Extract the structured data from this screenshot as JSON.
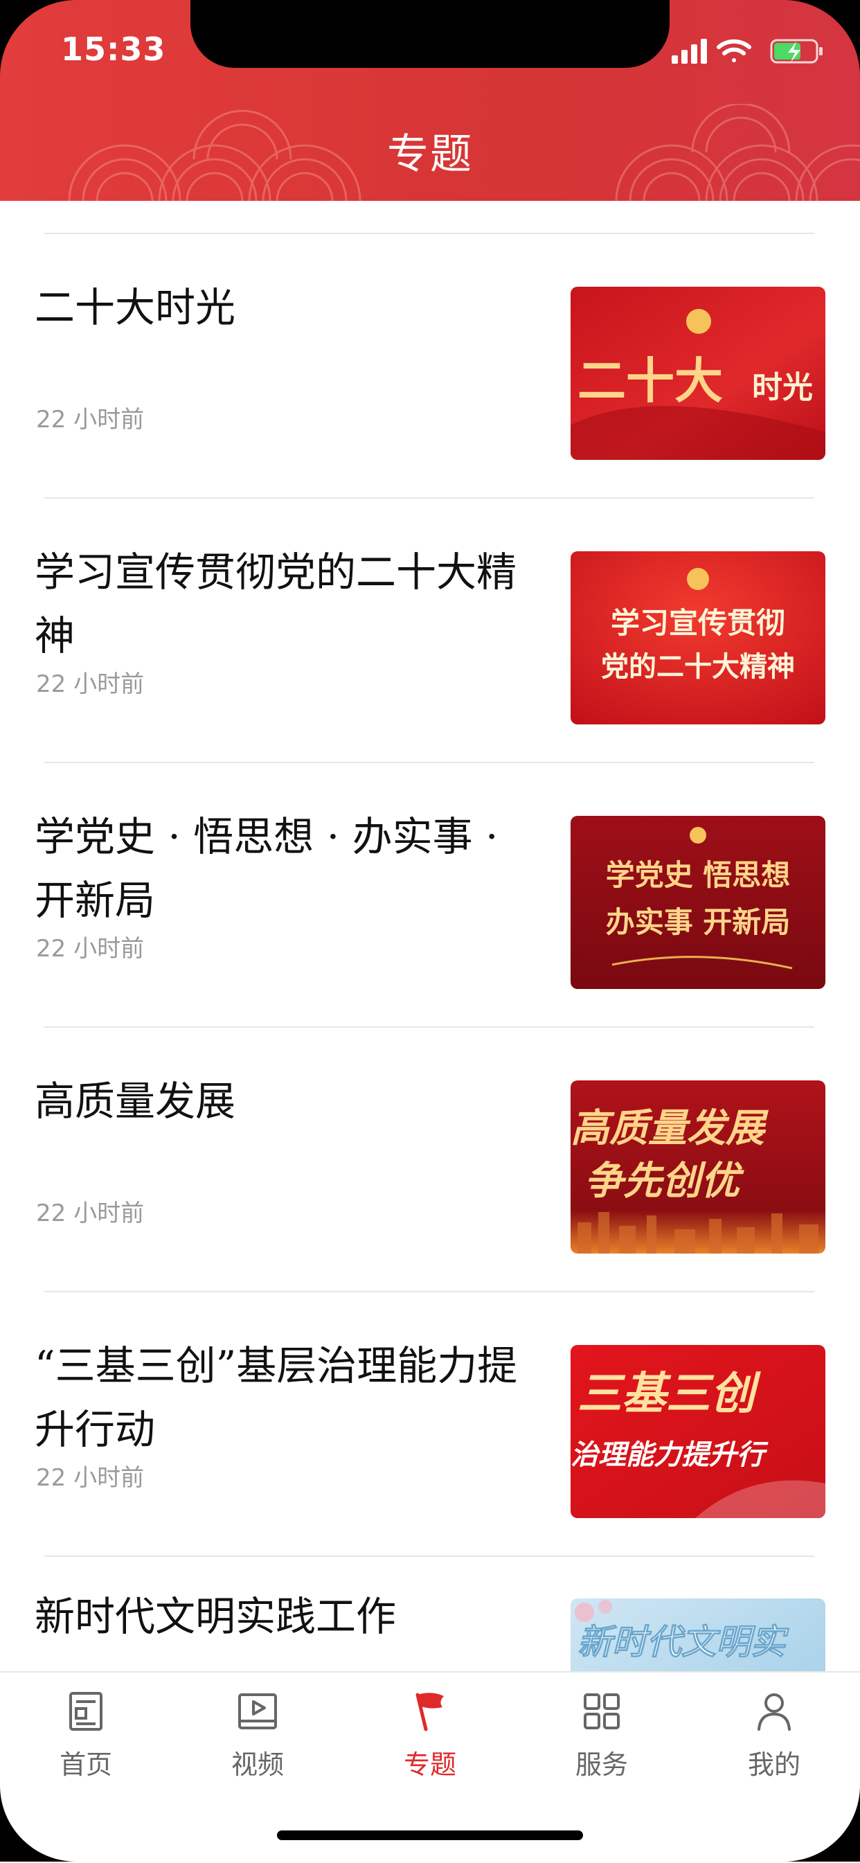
{
  "status_bar": {
    "time": "15:33"
  },
  "header": {
    "title": "专题"
  },
  "items": [
    {
      "title": "二十大时光",
      "time": "22 小时前",
      "thumb_text": [
        "二十大",
        "时光"
      ]
    },
    {
      "title": "学习宣传贯彻党的二十大精神",
      "time": "22 小时前",
      "thumb_text": [
        "学习宣传贯彻",
        "党的二十大精神"
      ]
    },
    {
      "title": "学党史 · 悟思想 · 办实事 · 开新局",
      "time": "22 小时前",
      "thumb_text": [
        "学党史  悟思想",
        "办实事  开新局"
      ]
    },
    {
      "title": "高质量发展",
      "time": "22 小时前",
      "thumb_text": [
        "高质量发展",
        "争先创优"
      ]
    },
    {
      "title": "“三基三创”基层治理能力提升行动",
      "time": "22 小时前",
      "thumb_text": [
        "三基三创",
        "治理能力提升行"
      ]
    },
    {
      "title": "新时代文明实践工作",
      "time": "",
      "thumb_text": [
        "新时代文明实"
      ]
    }
  ],
  "tabbar": [
    {
      "label": "首页",
      "icon": "news-icon",
      "active": false
    },
    {
      "label": "视频",
      "icon": "video-icon",
      "active": false
    },
    {
      "label": "专题",
      "icon": "flag-icon",
      "active": true
    },
    {
      "label": "服务",
      "icon": "grid-icon",
      "active": false
    },
    {
      "label": "我的",
      "icon": "user-icon",
      "active": false
    }
  ],
  "colors": {
    "brand_red": "#d93636",
    "active_tab": "#e02a2a",
    "time_gray": "#9a9a9a",
    "gold": "#ffd58a"
  }
}
